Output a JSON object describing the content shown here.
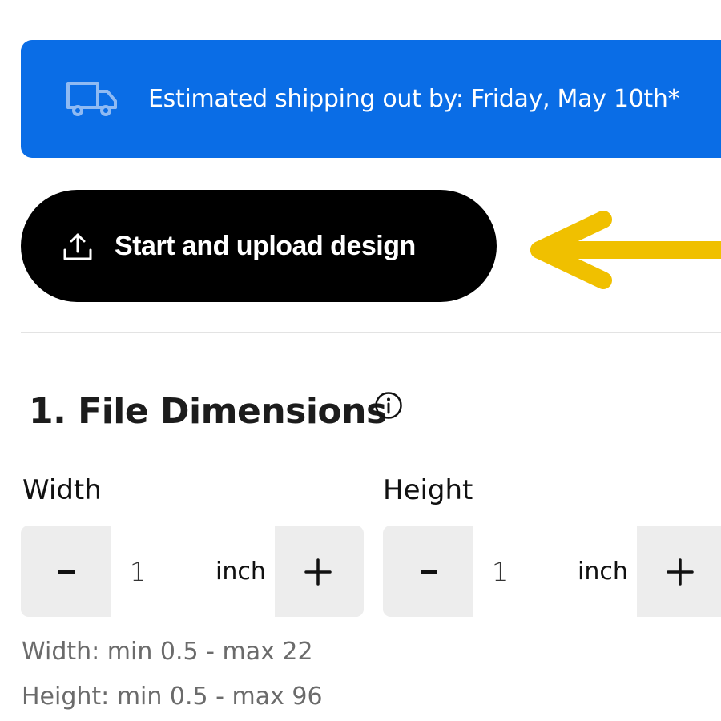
{
  "banner": {
    "icon": "truck-icon",
    "text": "Estimated shipping out by: Friday, May 10th*",
    "background_color": "#0a6de6",
    "text_color": "#ffffff"
  },
  "upload": {
    "label": "Start and upload design",
    "icon": "upload-icon",
    "background_color": "#000000"
  },
  "annotation": {
    "icon": "arrow-left-icon",
    "color": "#f0c000"
  },
  "section": {
    "title": "1. File Dimensions",
    "info_icon": "info-icon"
  },
  "dimensions": {
    "width": {
      "label": "Width",
      "value": "1",
      "unit": "inch",
      "decrement_label": "-",
      "increment_label": "+",
      "hint": "Width: min 0.5 - max 22"
    },
    "height": {
      "label": "Height",
      "value": "1",
      "unit": "inch",
      "decrement_label": "-",
      "increment_label": "+",
      "hint": "Height: min 0.5 - max 96"
    }
  }
}
